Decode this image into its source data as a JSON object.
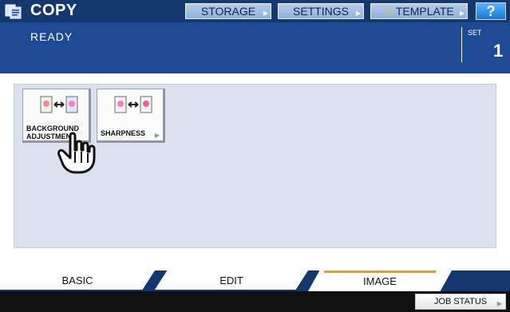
{
  "header": {
    "app_title": "COPY",
    "buttons": {
      "storage": "STORAGE",
      "settings": "SETTINGS",
      "template": "TEMPLATE",
      "help": "?"
    },
    "status": "READY",
    "set_label": "SET",
    "set_value": "1"
  },
  "functions": [
    {
      "label_line1": "BACKGROUND",
      "label_line2": "ADJUSTMENT"
    },
    {
      "label": "SHARPNESS"
    }
  ],
  "tabs": {
    "basic": "BASIC",
    "edit": "EDIT",
    "image": "IMAGE",
    "active": "image"
  },
  "footer": {
    "job_status": "JOB STATUS"
  },
  "colors": {
    "header": "#1d4a93",
    "topbar": "#15386f",
    "panel": "#dde0ee",
    "active_tab_underline": "#f19a1a"
  },
  "icons": {
    "app": "copy-icon",
    "help": "help-icon",
    "pointer": "hand-pointer-icon"
  }
}
